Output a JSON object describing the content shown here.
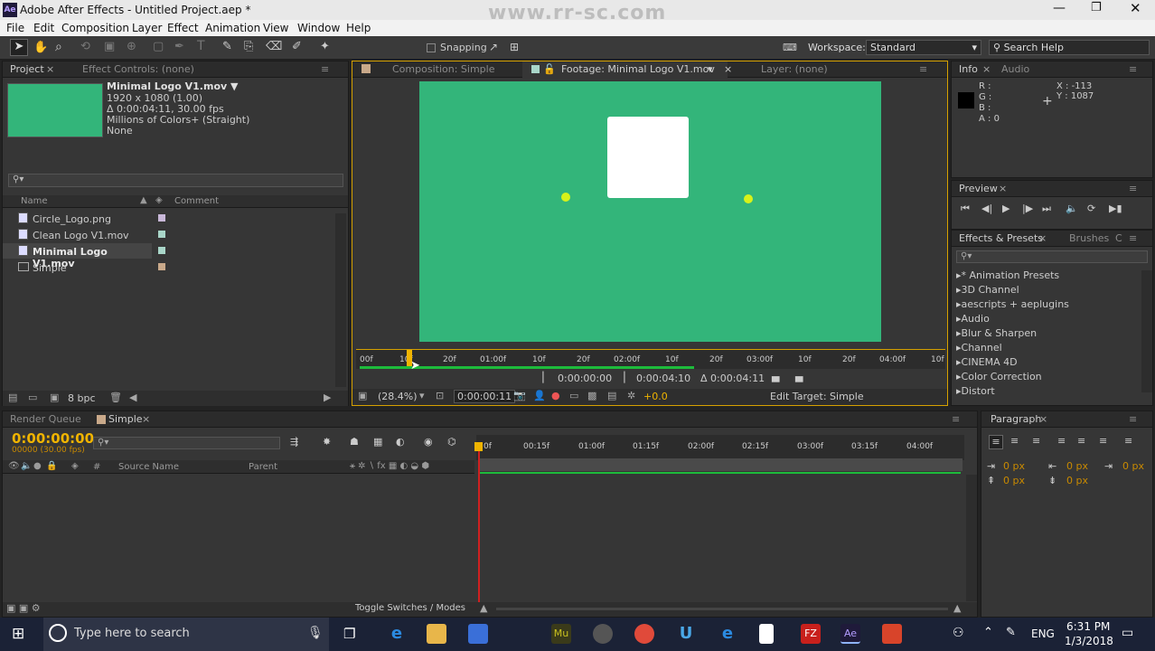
{
  "window": {
    "title": "Adobe After Effects - Untitled Project.aep *",
    "app_icon": "Ae",
    "watermark": "www.rr-sc.com"
  },
  "menu": [
    "File",
    "Edit",
    "Composition",
    "Layer",
    "Effect",
    "Animation",
    "View",
    "Window",
    "Help"
  ],
  "toolbar": {
    "snapping_label": "Snapping",
    "workspace_label": "Workspace:",
    "workspace_value": "Standard",
    "search_help": "Search Help"
  },
  "project": {
    "tab_project": "Project",
    "tab_effect_controls": "Effect Controls: (none)",
    "selected_name": "Minimal Logo V1.mov ▼",
    "info_lines": [
      "1920 x 1080 (1.00)",
      "Δ 0:00:04:11, 30.00 fps",
      "Millions of Colors+ (Straight)",
      "None"
    ],
    "col_name": "Name",
    "col_comment": "Comment",
    "items": [
      {
        "name": "Circle_Logo.png",
        "swatch": "#c9b8d9"
      },
      {
        "name": "Clean Logo V1.mov",
        "swatch": "#a9d6c9"
      },
      {
        "name": "Minimal Logo V1.mov",
        "swatch": "#a9d6c9"
      },
      {
        "name": "Simple",
        "swatch": "#c9a98a"
      }
    ],
    "bpc": "8 bpc"
  },
  "viewer": {
    "tab_comp": "Composition: Simple",
    "tab_footage": "Footage: Minimal Logo V1.mov",
    "tab_layer": "Layer: (none)",
    "bg_color": "#33b57a",
    "ruler_labels": [
      "00f",
      "10f",
      "20f",
      "01:00f",
      "10f",
      "20f",
      "02:00f",
      "10f",
      "20f",
      "03:00f",
      "10f",
      "20f",
      "04:00f",
      "10f"
    ],
    "in_point": "0:00:00:00",
    "out_point": "0:00:04:10",
    "duration": "Δ 0:00:04:11",
    "zoom": "(28.4%)",
    "current_time": "0:00:00:11",
    "exposure": "+0.0",
    "edit_target": "Edit Target: Simple"
  },
  "info": {
    "tab_info": "Info",
    "tab_audio": "Audio",
    "r": "R :",
    "g": "G :",
    "b": "B :",
    "a": "A : 0",
    "x": "X : -113",
    "y": "Y : 1087"
  },
  "preview": {
    "tab": "Preview"
  },
  "effects": {
    "tab": "Effects & Presets",
    "tab_brushes": "Brushes",
    "tab_c": "C",
    "items": [
      "* Animation Presets",
      "3D Channel",
      "aescripts + aeplugins",
      "Audio",
      "Blur & Sharpen",
      "Channel",
      "CINEMA 4D",
      "Color Correction",
      "Distort"
    ]
  },
  "timeline": {
    "tab_render": "Render Queue",
    "tab_simple": "Simple",
    "timecode": "0:00:00:00",
    "fps": "00000 (30.00 fps)",
    "col_source": "Source Name",
    "col_parent": "Parent",
    "col_num": "#",
    "ruler": [
      "0f",
      "00:15f",
      "01:00f",
      "01:15f",
      "02:00f",
      "02:15f",
      "03:00f",
      "03:15f",
      "04:00f"
    ],
    "toggle": "Toggle Switches / Modes"
  },
  "paragraph": {
    "tab": "Paragraph",
    "px_values": [
      "0 px",
      "0 px",
      "0 px",
      "0 px",
      "0 px"
    ]
  },
  "taskbar": {
    "search": "Type here to search",
    "lang": "ENG",
    "time": "6:31 PM",
    "date": "1/3/2018"
  },
  "colors": {
    "accent": "#f0b400",
    "panel": "#363636",
    "green_bar": "#1dbb3b"
  }
}
